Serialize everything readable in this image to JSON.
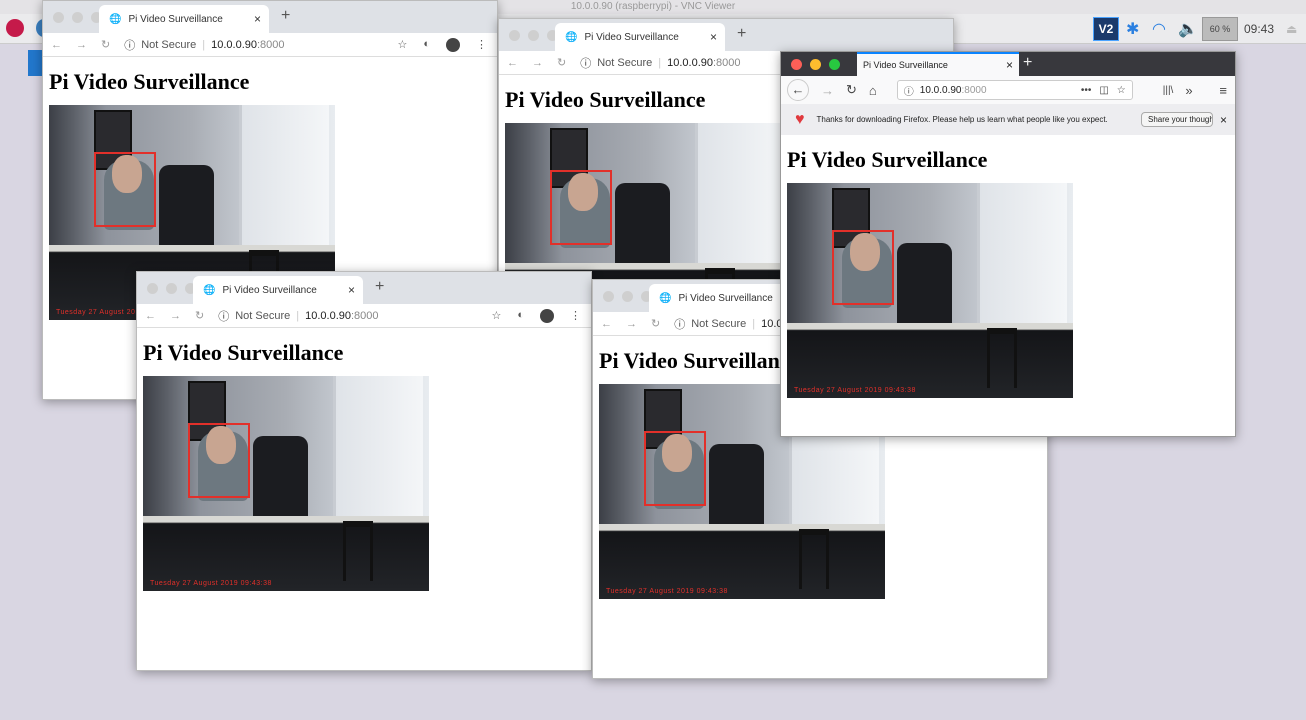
{
  "vnc_title": "10.0.0.90 (raspberrypi) - VNC Viewer",
  "taskbar": {
    "vnc": "V2",
    "bluetooth": "✱",
    "wifi": "◠",
    "volume": "🔈",
    "cpu": "60 %",
    "clock": "09:43",
    "eject": "⏏"
  },
  "page": {
    "title": "Pi Video Surveillance",
    "timestamp": "Tuesday 27 August 2019 09:43:38"
  },
  "chrome": {
    "tab_title": "Pi Video Surveillance",
    "not_secure": "Not Secure",
    "host": "10.0.0.90",
    "port": ":8000",
    "back": "←",
    "forward": "→",
    "reload": "↻",
    "star": "☆",
    "close": "×",
    "new_tab": "+",
    "menu": "⋮",
    "info": "ⓘ"
  },
  "firefox": {
    "tab_title": "Pi Video Surveillance",
    "host": "10.0.0.90",
    "port": ":8000",
    "notification": "Thanks for downloading Firefox. Please help us learn what people like you expect.",
    "share_button": "Share your thoughts",
    "close": "×",
    "new_tab": "+",
    "back": "←",
    "forward": "→",
    "reload": "↻",
    "home": "⌂",
    "more": "•••",
    "pocket": "◫",
    "star": "☆",
    "library": "|||\\",
    "overflow": "»",
    "menu": "≡"
  },
  "windows": [
    "w1",
    "w2",
    "w3",
    "w4"
  ]
}
